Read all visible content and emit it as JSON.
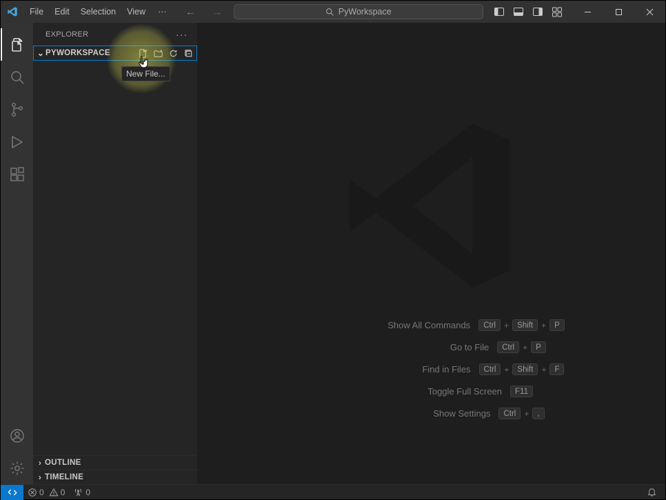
{
  "menu": {
    "file": "File",
    "edit": "Edit",
    "selection": "Selection",
    "view": "View",
    "more": "···"
  },
  "search": {
    "text": "PyWorkspace"
  },
  "explorer": {
    "title": "EXPLORER",
    "more": "···",
    "folder": "PYWORKSPACE",
    "tooltip": "New File...",
    "outline": "OUTLINE",
    "timeline": "TIMELINE"
  },
  "welcome": {
    "rows": [
      {
        "label": "Show All Commands",
        "keys": [
          "Ctrl",
          "Shift",
          "P"
        ]
      },
      {
        "label": "Go to File",
        "keys": [
          "Ctrl",
          "P"
        ]
      },
      {
        "label": "Find in Files",
        "keys": [
          "Ctrl",
          "Shift",
          "F"
        ]
      },
      {
        "label": "Toggle Full Screen",
        "keys": [
          "F11"
        ]
      },
      {
        "label": "Show Settings",
        "keys": [
          "Ctrl",
          ","
        ]
      }
    ]
  },
  "status": {
    "errors": "0",
    "warnings": "0",
    "ports": "0"
  }
}
